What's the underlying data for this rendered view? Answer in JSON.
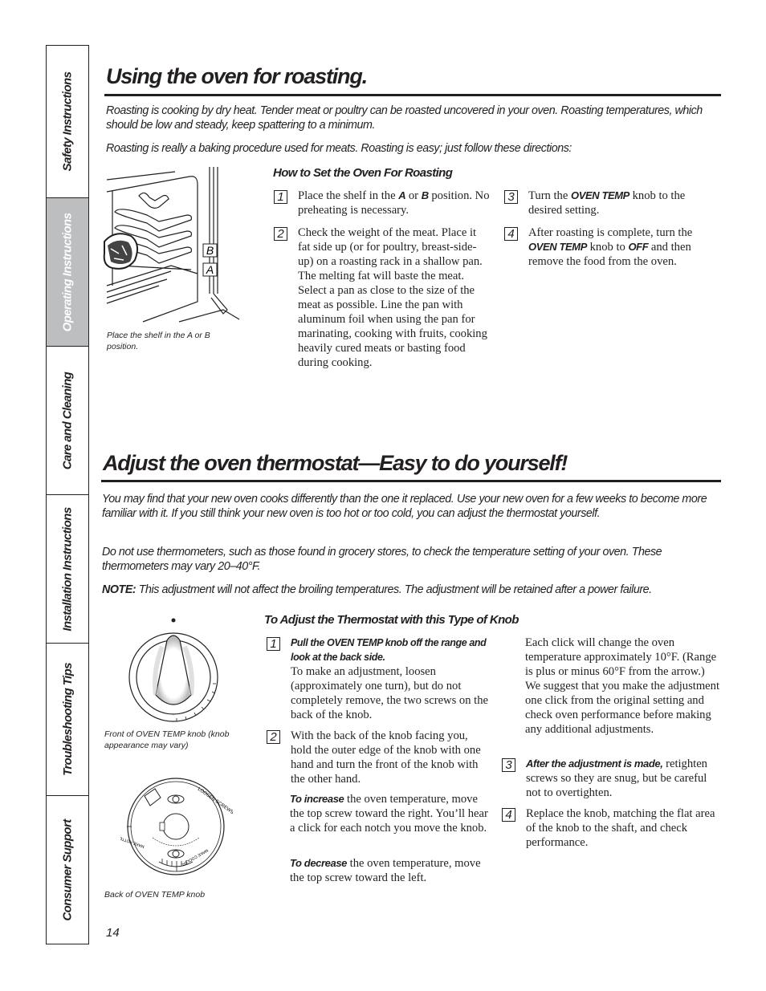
{
  "side_tabs": [
    {
      "label": "Safety Instructions",
      "active": false
    },
    {
      "label": "Operating Instructions",
      "active": true
    },
    {
      "label": "Care and Cleaning",
      "active": false
    },
    {
      "label": "Installation Instructions",
      "active": false
    },
    {
      "label": "Troubleshooting Tips",
      "active": false
    },
    {
      "label": "Consumer Support",
      "active": false
    }
  ],
  "roasting": {
    "title": "Using the oven for roasting.",
    "intro1": "Roasting is cooking by dry heat. Tender meat or poultry can be roasted uncovered in your oven. Roasting temperatures, which should be low and steady, keep spattering to a minimum.",
    "intro2": "Roasting is really a baking procedure used for meats. Roasting is easy; just follow these directions:",
    "figure_labels": {
      "b": "B",
      "a": "A"
    },
    "figure_caption": "Place the shelf in the A or B position.",
    "subhead": "How to Set the Oven For Roasting",
    "steps": [
      {
        "num": "1",
        "pre": "Place the shelf in the ",
        "b1": "A",
        "mid": " or ",
        "b2": "B",
        "post": " position. No preheating is necessary."
      },
      {
        "num": "2",
        "text": "Check the weight of the meat. Place it fat side up (or for poultry, breast-side-up) on a roasting rack in a shallow pan. The melting fat will baste the meat. Select a pan as close to the size of the meat as possible. Line the pan with aluminum foil when using the pan for marinating, cooking with fruits, cooking heavily cured meats or basting food during cooking."
      },
      {
        "num": "3",
        "pre": "Turn the ",
        "b1": "OVEN TEMP",
        "post": " knob to the desired setting."
      },
      {
        "num": "4",
        "pre": "After roasting is complete, turn the ",
        "b1": "OVEN TEMP",
        "mid": " knob to ",
        "b2": "OFF",
        "post": " and then remove the food from the oven."
      }
    ]
  },
  "thermostat": {
    "title": "Adjust the oven thermostat—Easy to do yourself!",
    "intro1": "You may find that your new oven cooks differently than the one it replaced. Use your new oven for a few weeks to become more familiar with it. If you still think your new oven is too hot or too cold, you can adjust the thermostat yourself.",
    "intro2": "Do not use thermometers, such as those found in grocery stores, to check the temperature setting of your oven. These thermometers may vary 20–40°F.",
    "note_label": "NOTE:",
    "note_text": " This adjustment will not affect the broiling temperatures. The adjustment will be retained after a power failure.",
    "front_caption": "Front of OVEN TEMP knob (knob appearance may vary)",
    "back_caption": "Back of OVEN TEMP knob",
    "back_knob_labels": {
      "loosen": "LOOSEN SCREWS TO ROTATE",
      "hotter": "MAKE HOTTER",
      "cooler": "MAKE COOLER"
    },
    "subhead": "To Adjust the Thermostat with this Type of Knob",
    "step1": {
      "num": "1",
      "bold": "Pull the OVEN TEMP knob off the range and look at the back side.",
      "text": "To make an adjustment, loosen (approximately one turn), but do not completely remove, the two screws on the back of the knob."
    },
    "step2": {
      "num": "2",
      "text": "With the back of the knob facing you, hold the outer edge of the knob with one hand and turn the front of the knob with the other hand."
    },
    "increase": {
      "bold": "To increase",
      "text": " the oven temperature, move the top screw toward the right. You’ll hear a click for each notch you move the knob."
    },
    "decrease": {
      "bold": "To decrease",
      "text": " the oven temperature, move the top screw toward the left."
    },
    "click_note": "Each click will change the oven temperature approximately 10°F. (Range is plus or minus 60°F from the arrow.) We suggest that you make the adjustment one click from the original setting and check oven performance before making any additional adjustments.",
    "step3": {
      "num": "3",
      "bold": "After the adjustment is made,",
      "text": " retighten screws so they are snug, but be careful not to overtighten."
    },
    "step4": {
      "num": "4",
      "text": "Replace the knob, matching the flat area of the knob to the shaft, and check performance."
    }
  },
  "page_number": "14"
}
